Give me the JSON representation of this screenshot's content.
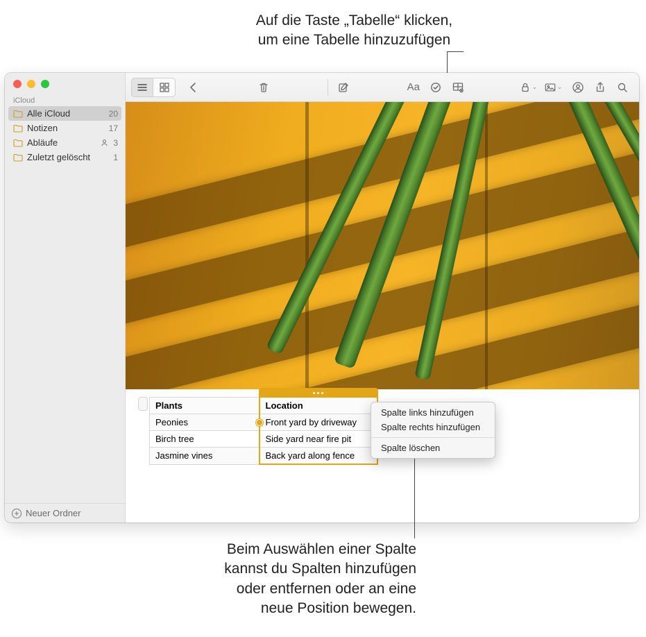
{
  "callouts": {
    "top_line1": "Auf die Taste „Tabelle“ klicken,",
    "top_line2": "um eine Tabelle hinzuzufügen",
    "bottom_line1": "Beim Auswählen einer Spalte",
    "bottom_line2": "kannst du Spalten hinzufügen",
    "bottom_line3": "oder entfernen oder an eine",
    "bottom_line4": "neue Position bewegen."
  },
  "sidebar": {
    "section_label": "iCloud",
    "items": [
      {
        "label": "Alle iCloud",
        "count": "20",
        "selected": true,
        "shared": false
      },
      {
        "label": "Notizen",
        "count": "17",
        "selected": false,
        "shared": false
      },
      {
        "label": "Abläufe",
        "count": "3",
        "selected": false,
        "shared": true
      },
      {
        "label": "Zuletzt gelöscht",
        "count": "1",
        "selected": false,
        "shared": false
      }
    ],
    "new_folder_label": "Neuer Ordner"
  },
  "toolbar": {
    "view_list": "list-icon",
    "view_grid": "grid-icon",
    "back": "chevron-left-icon",
    "trash": "trash-icon",
    "compose": "compose-icon",
    "format": "Aa",
    "checklist": "checklist-icon",
    "table": "table-icon",
    "lock": "lock-icon",
    "media": "photo-icon",
    "collab": "person-icon",
    "share": "share-icon",
    "search": "search-icon"
  },
  "note_table": {
    "headers": [
      "Plants",
      "Location"
    ],
    "rows": [
      [
        "Peonies",
        "Front yard by driveway"
      ],
      [
        "Birch tree",
        "Side yard near fire pit"
      ],
      [
        "Jasmine vines",
        "Back yard along fence"
      ]
    ]
  },
  "context_menu": {
    "items": [
      "Spalte links hinzufügen",
      "Spalte rechts hinzufügen"
    ],
    "after_sep": [
      "Spalte löschen"
    ]
  }
}
